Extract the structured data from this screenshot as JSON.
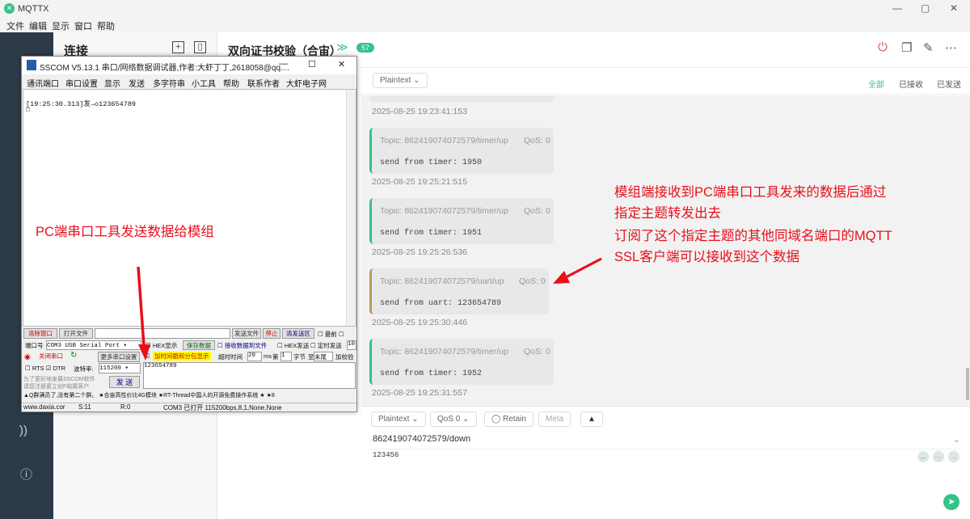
{
  "app": {
    "title": "MQTTX"
  },
  "menu": [
    "文件",
    "编辑",
    "显示",
    "窗口",
    "帮助"
  ],
  "connections": {
    "title": "连接"
  },
  "header": {
    "connection_name": "双向证书校验（合宙）",
    "count": "57"
  },
  "filter": {
    "format": "Plaintext",
    "tabs": [
      "全部",
      "已接收",
      "已发送"
    ]
  },
  "messages": {
    "first_timestamp": "2025-08-25 19:23:41:153",
    "items": [
      {
        "topic": "Topic: 862419074072579/timer/up",
        "qos": "QoS: 0",
        "payload": "send from timer: 1950",
        "time": "2025-08-25 19:25:21:515",
        "color": "#34c388"
      },
      {
        "topic": "Topic: 862419074072579/timer/up",
        "qos": "QoS: 0",
        "payload": "send from timer: 1951",
        "time": "2025-08-25 19:25:26:536",
        "color": "#34c388"
      },
      {
        "topic": "Topic: 862419074072579/uart/up",
        "qos": "QoS: 0",
        "payload": "send from uart: 123654789",
        "time": "2025-08-25 19:25:30:446",
        "color": "#b89a5a"
      },
      {
        "topic": "Topic: 862419074072579/timer/up",
        "qos": "QoS: 0",
        "payload": "send from timer: 1952",
        "time": "2025-08-25 19:25:31:557",
        "color": "#34c388"
      }
    ]
  },
  "publish": {
    "format": "Plaintext",
    "qos": "QoS 0",
    "retain": "Retain",
    "meta": "Meta",
    "topic": "862419074072579/down",
    "payload": "123456"
  },
  "sscom": {
    "title": "SSCOM V5.13.1 串口/网络数据调试器,作者:大虾丁丁,2618058@qq....",
    "menu": [
      "通讯端口",
      "串口设置",
      "显示",
      "发送",
      "多字符串",
      "小工具",
      "帮助",
      "联系作者",
      "大虾电子网"
    ],
    "rx_line": "[19:25:30.313]发→◇123654789",
    "rx_line2": "□",
    "clear_btn": "清除窗口",
    "open_file_btn": "打开文件",
    "send_file_btn": "发送文件",
    "stop_btn": "停止",
    "clear_send_btn": "清发送区",
    "top_label": "最前",
    "port_label": "端口号",
    "port_value": "COM3 USB Serial Port",
    "hex_show": "HEX显示",
    "save_data": "保存数据",
    "recv_to_file": "接收数据到文件",
    "hex_send": "HEX发送",
    "timed_send": "定时发送",
    "timed_value": "10",
    "close_port_btn": "关闭串口",
    "more_settings_btn": "更多串口设置",
    "timestamp_label": "加时间戳和分包显示",
    "timeout_label": "超时时间",
    "timeout_value": "20",
    "ms": "ms",
    "nth_label": "第",
    "byte_value": "1",
    "byte_label": "字节",
    "to_label": "至",
    "end_value": "末尾",
    "checksum_label": "加校验",
    "rts": "RTS",
    "dtr": "DTR",
    "baud_label": "波特率:",
    "baud_value": "115200",
    "send_text": "123654789",
    "promo1": "为了更好地发展SSCOM软件",
    "promo2": "请您注册嘉立创F结尾客户",
    "send_btn": "发 送",
    "ticker": "▲Q群满员了,没有第二个群。  ★合宙高性价比4G模块  ★RT-Thread中国人的开源免费操作系统  ★ ★8",
    "status_site": "www.daxia.cor",
    "status_s": "S:11",
    "status_r": "R:0",
    "status_port": "COM3 已打开  115200bps,8,1,None,None"
  },
  "annotations": {
    "left": "PC端串口工具发送数据给模组",
    "right": [
      "模组端接收到PC端串口工具发来的数据后通过",
      "指定主题转发出去",
      "订阅了这个指定主题的其他同域名端口的MQTT",
      "SSL客户端可以接收到这个数据"
    ],
    "color": "#e8101a"
  }
}
